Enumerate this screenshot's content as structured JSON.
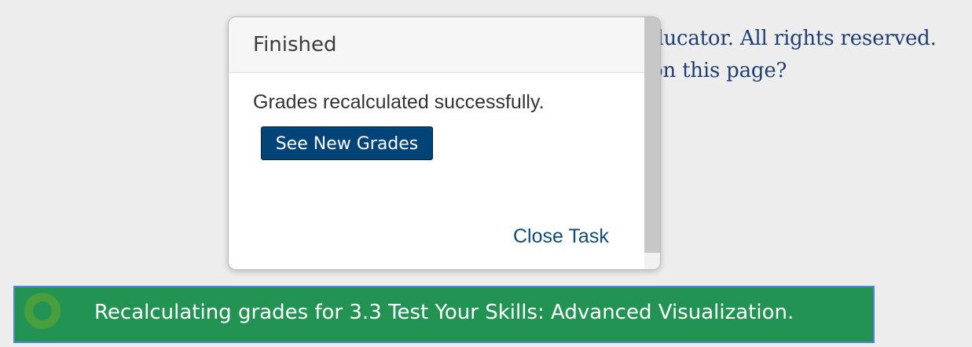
{
  "background": {
    "copyright_fragment": "ducator. All rights reserved.",
    "question_fragment": "on this page?"
  },
  "dialog": {
    "title": "Finished",
    "message": "Grades recalculated successfully.",
    "primary_button_label": "See New Grades",
    "close_link_label": "Close Task"
  },
  "status": {
    "message": "Recalculating grades for 3.3 Test Your Skills: Advanced Visualization.",
    "icon": "loading-spinner-icon",
    "color": "#229353"
  },
  "colors": {
    "primary_button": "#024477",
    "link": "#114b7a",
    "background_text": "#1f3f73"
  }
}
